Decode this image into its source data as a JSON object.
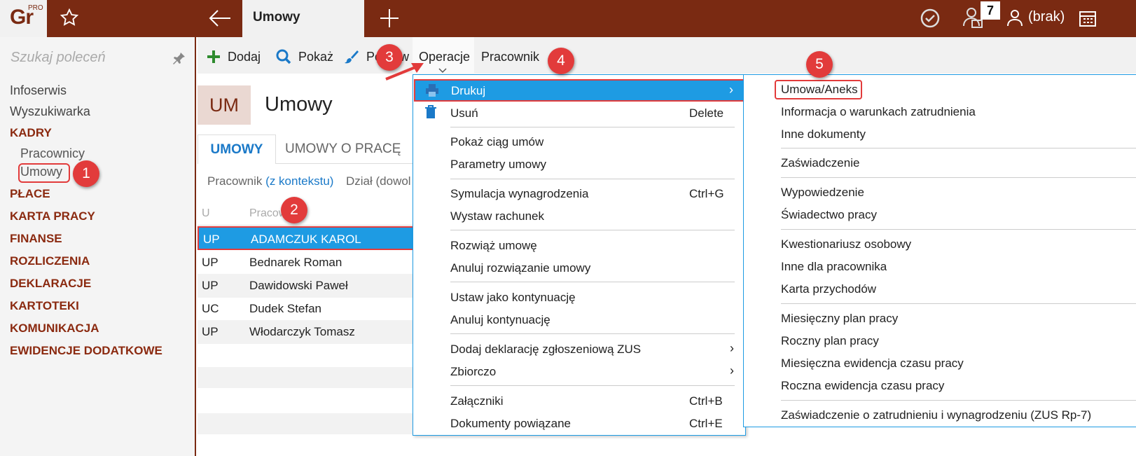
{
  "topbar": {
    "logo": "Gr",
    "logo_sup": "PRO",
    "active_tab": "Umowy",
    "badge_count": "7",
    "user": "(brak)",
    "colors": {
      "bar": "#7a2a12",
      "accent": "#1e9be3",
      "highlight": "#e23b3b"
    }
  },
  "sidebar": {
    "search_placeholder": "Szukaj poleceń",
    "items": [
      {
        "label": "Infoserwis"
      },
      {
        "label": "Wyszukiwarka"
      },
      {
        "label": "KADRY"
      },
      {
        "label": "Pracownicy"
      },
      {
        "label": "Umowy"
      },
      {
        "label": "PŁACE"
      },
      {
        "label": "KARTA PRACY"
      },
      {
        "label": "FINANSE"
      },
      {
        "label": "ROZLICZENIA"
      },
      {
        "label": "DEKLARACJE"
      },
      {
        "label": "KARTOTEKI"
      },
      {
        "label": "KOMUNIKACJA"
      },
      {
        "label": "EWIDENCJE DODATKOWE"
      }
    ]
  },
  "toolbar": {
    "add": "Dodaj",
    "show": "Pokaż",
    "edit": "Popraw",
    "operations": "Operacje",
    "employee": "Pracownik"
  },
  "page": {
    "code": "UM",
    "title": "Umowy",
    "tabs": [
      "UMOWY",
      "UMOWY O PRACĘ"
    ],
    "filter_label": "Pracownik",
    "filter_link": "(z kontekstu)",
    "filter2": "Dział (dowol"
  },
  "table": {
    "headers": [
      "U",
      "Pracownik"
    ],
    "rows": [
      {
        "u": "UP",
        "name": "ADAMCZUK KAROL"
      },
      {
        "u": "UP",
        "name": "Bednarek Roman"
      },
      {
        "u": "UP",
        "name": "Dawidowski Paweł"
      },
      {
        "u": "UC",
        "name": "Dudek Stefan"
      },
      {
        "u": "UP",
        "name": "Włodarczyk Tomasz"
      }
    ]
  },
  "menu": {
    "items": [
      {
        "label": "Drukuj"
      },
      {
        "label": "Usuń",
        "shortcut": "Delete"
      },
      {
        "label": "Pokaż ciąg umów"
      },
      {
        "label": "Parametry umowy"
      },
      {
        "label": "Symulacja wynagrodzenia",
        "shortcut": "Ctrl+G"
      },
      {
        "label": "Wystaw rachunek"
      },
      {
        "label": "Rozwiąż umowę"
      },
      {
        "label": "Anuluj rozwiązanie umowy"
      },
      {
        "label": "Ustaw jako kontynuację"
      },
      {
        "label": "Anuluj kontynuację"
      },
      {
        "label": "Dodaj deklarację zgłoszeniową ZUS"
      },
      {
        "label": "Zbiorczo"
      },
      {
        "label": "Załączniki",
        "shortcut": "Ctrl+B"
      },
      {
        "label": "Dokumenty powiązane",
        "shortcut": "Ctrl+E"
      }
    ]
  },
  "submenu": {
    "items": [
      {
        "label": "Umowa/Aneks"
      },
      {
        "label": "Informacja o warunkach zatrudnienia"
      },
      {
        "label": "Inne dokumenty"
      },
      {
        "label": "Zaświadczenie"
      },
      {
        "label": "Wypowiedzenie"
      },
      {
        "label": "Świadectwo pracy"
      },
      {
        "label": "Kwestionariusz osobowy"
      },
      {
        "label": "Inne dla pracownika"
      },
      {
        "label": "Karta przychodów"
      },
      {
        "label": "Miesięczny plan pracy"
      },
      {
        "label": "Roczny plan pracy"
      },
      {
        "label": "Miesięczna ewidencja czasu pracy"
      },
      {
        "label": "Roczna ewidencja czasu pracy"
      },
      {
        "label": "Zaświadczenie o zatrudnieniu i wynagrodzeniu (ZUS Rp-7)"
      }
    ]
  },
  "annotations": [
    "1",
    "2",
    "3",
    "4",
    "5"
  ]
}
